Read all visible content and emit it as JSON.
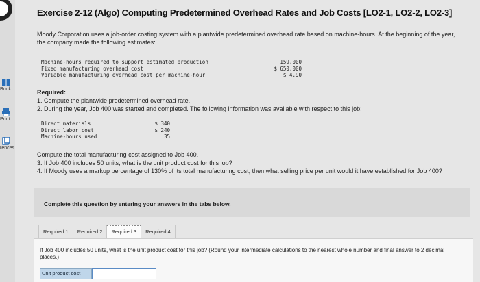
{
  "sidebar": {
    "book_label": "Book",
    "print_label": "Print",
    "references_label": "rences"
  },
  "title": "Exercise 2-12 (Algo) Computing Predetermined Overhead Rates and Job Costs [LO2-1, LO2-2, LO2-3]",
  "intro": "Moody Corporation uses a job-order costing system with a plantwide predetermined overhead rate based on machine-hours. At the beginning of the year, the company made the following estimates:",
  "estimates": [
    {
      "label": "Machine-hours required to support estimated production",
      "value": "159,000"
    },
    {
      "label": "Fixed manufacturing overhead cost",
      "value": "$ 650,000"
    },
    {
      "label": "Variable manufacturing overhead cost per machine-hour",
      "value": "$ 4.90"
    }
  ],
  "required_heading": "Required:",
  "requirements_part1": [
    "1. Compute the plantwide predetermined overhead rate.",
    "2. During the year, Job 400 was started and completed. The following information was available with respect to this job:"
  ],
  "job_info": [
    {
      "label": "Direct materials",
      "value": "$ 340"
    },
    {
      "label": "Direct labor cost",
      "value": "$ 240"
    },
    {
      "label": "Machine-hours used",
      "value": "35"
    }
  ],
  "requirements_part2": [
    "Compute the total manufacturing cost assigned to Job 400.",
    "3. If Job 400 includes 50 units, what is the unit product cost for this job?",
    "4. If Moody uses a markup percentage of 130% of its total manufacturing cost, then what selling price per unit would it have established for Job 400?"
  ],
  "panel_text": "Complete this question by entering your answers in the tabs below.",
  "tabs": [
    {
      "label": "Required 1",
      "active": false
    },
    {
      "label": "Required 2",
      "active": false
    },
    {
      "label": "Required 3",
      "active": true
    },
    {
      "label": "Required 4",
      "active": false
    }
  ],
  "question": "If Job 400 includes 50 units, what is the unit product cost for this job? (Round your intermediate calculations to the nearest whole number and final answer to 2 decimal places.)",
  "answer": {
    "label": "Unit product cost",
    "value": ""
  }
}
